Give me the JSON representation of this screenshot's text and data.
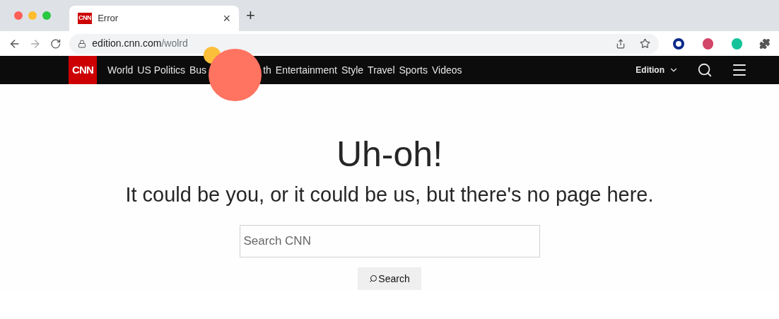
{
  "browser": {
    "tab": {
      "favicon_text": "CNN",
      "title": "Error",
      "close": "×"
    },
    "new_tab": "+",
    "url": {
      "host": "edition.cnn.com",
      "path": "/wolrd"
    }
  },
  "site_nav": {
    "logo": "CNN",
    "items": [
      "World",
      "US Politics",
      "Bus",
      "th",
      "Entertainment",
      "Style",
      "Travel",
      "Sports",
      "Videos"
    ],
    "edition": "Edition"
  },
  "error": {
    "heading": "Uh-oh!",
    "message": "It could be you, or it could be us, but there's no page here."
  },
  "search": {
    "placeholder": "Search CNN",
    "button": "Search"
  }
}
